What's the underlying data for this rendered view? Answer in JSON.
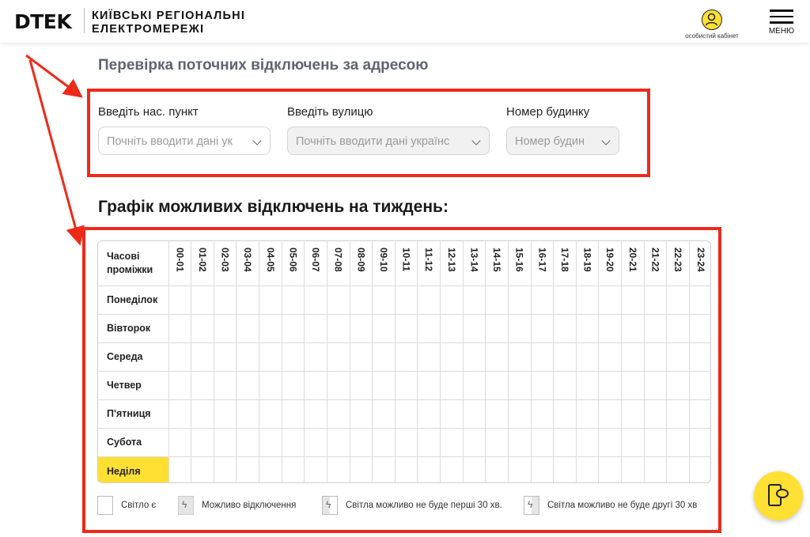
{
  "header": {
    "logo": "DTEK",
    "company_line1": "КИЇВСЬКІ РЕГІОНАЛЬНІ",
    "company_line2": "ЕЛЕКТРОМЕРЕЖІ",
    "cabinet_label": "особистий кабінет",
    "menu_label": "МЕНЮ"
  },
  "check": {
    "title": "Перевірка поточних відключень за адресою",
    "city_label": "Введіть нас. пункт",
    "city_placeholder": "Почніть вводити дані ук",
    "street_label": "Введіть вулицю",
    "street_placeholder": "Почніть вводити дані українс",
    "house_label": "Номер будинку",
    "house_placeholder": "Номер будин"
  },
  "schedule": {
    "title": "Графік можливих відключень на тиждень:",
    "corner_line1": "Часові",
    "corner_line2": "проміжки",
    "hours": [
      "00-01",
      "01-02",
      "02-03",
      "03-04",
      "04-05",
      "05-06",
      "06-07",
      "07-08",
      "08-09",
      "09-10",
      "10-11",
      "11-12",
      "12-13",
      "13-14",
      "14-15",
      "15-16",
      "16-17",
      "17-18",
      "18-19",
      "19-20",
      "20-21",
      "21-22",
      "22-23",
      "23-24"
    ],
    "days": [
      "Понеділок",
      "Вівторок",
      "Середа",
      "Четвер",
      "П'ятниця",
      "Субота",
      "Неділя"
    ],
    "today": "Неділя"
  },
  "legend": {
    "light_on": "Світло є",
    "maybe_off": "Можливо відключення",
    "first_half": "Світла можливо не буде перші 30 хв.",
    "second_half": "Світла можливо не буде другі 30 хв"
  },
  "colors": {
    "accent_yellow": "#ffe033",
    "annotation_red": "#ee2a1a",
    "title_gray": "#5e6470"
  },
  "icons": {
    "cabinet": "user-circle-icon",
    "menu": "hamburger-icon",
    "chat": "phone-chat-icon",
    "outage": "lightning-icon"
  }
}
